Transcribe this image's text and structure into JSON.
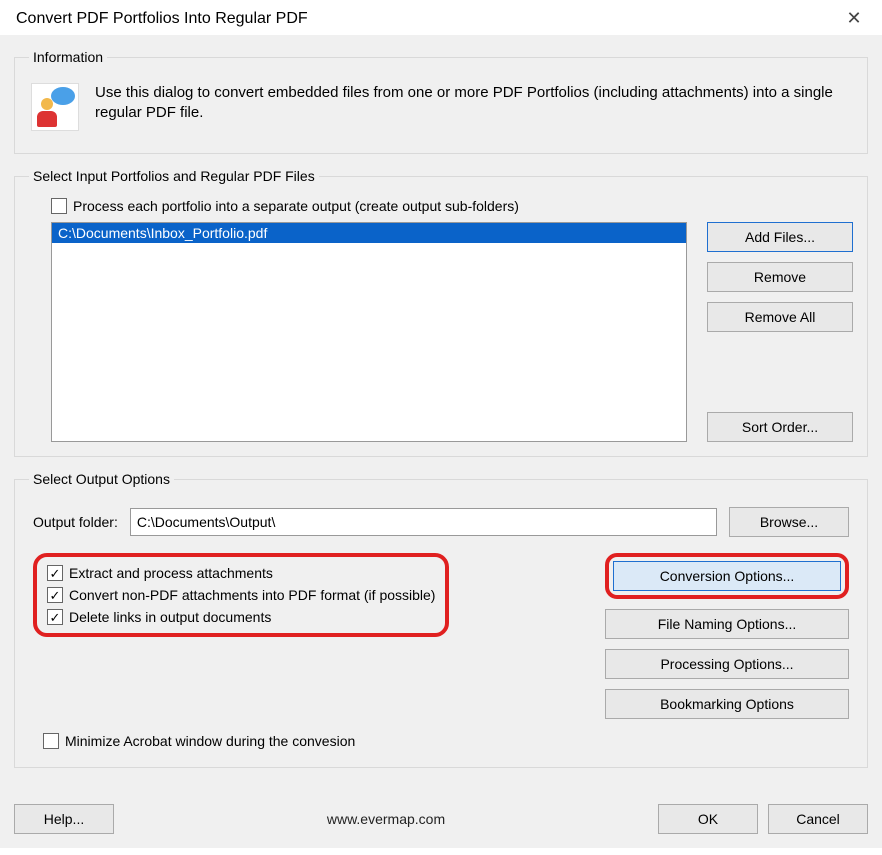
{
  "title": "Convert PDF Portfolios Into Regular PDF",
  "info": {
    "legend": "Information",
    "text": "Use this dialog to convert embedded files from one or more PDF Portfolios (including attachments) into a single regular PDF file."
  },
  "input": {
    "legend": "Select Input Portfolios and Regular PDF Files",
    "process_each_label": "Process each portfolio into a separate output (create output sub-folders)",
    "process_each_checked": false,
    "files": [
      "C:\\Documents\\Inbox_Portfolio.pdf"
    ],
    "btn_add": "Add Files...",
    "btn_remove": "Remove",
    "btn_remove_all": "Remove All",
    "btn_sort": "Sort Order..."
  },
  "output": {
    "legend": "Select Output Options",
    "folder_label": "Output folder:",
    "folder_value": "C:\\Documents\\Output\\",
    "btn_browse": "Browse...",
    "chk_extract": {
      "label": "Extract and process attachments",
      "checked": true
    },
    "chk_convert": {
      "label": "Convert non-PDF attachments into PDF format (if possible)",
      "checked": true
    },
    "chk_delete_links": {
      "label": "Delete links in output documents",
      "checked": true
    },
    "btn_conversion": "Conversion Options...",
    "btn_filenaming": "File Naming Options...",
    "btn_processing": "Processing Options...",
    "btn_bookmarking": "Bookmarking Options",
    "chk_minimize": {
      "label": "Minimize Acrobat window during the convesion",
      "checked": false
    }
  },
  "footer": {
    "help": "Help...",
    "url": "www.evermap.com",
    "ok": "OK",
    "cancel": "Cancel"
  }
}
